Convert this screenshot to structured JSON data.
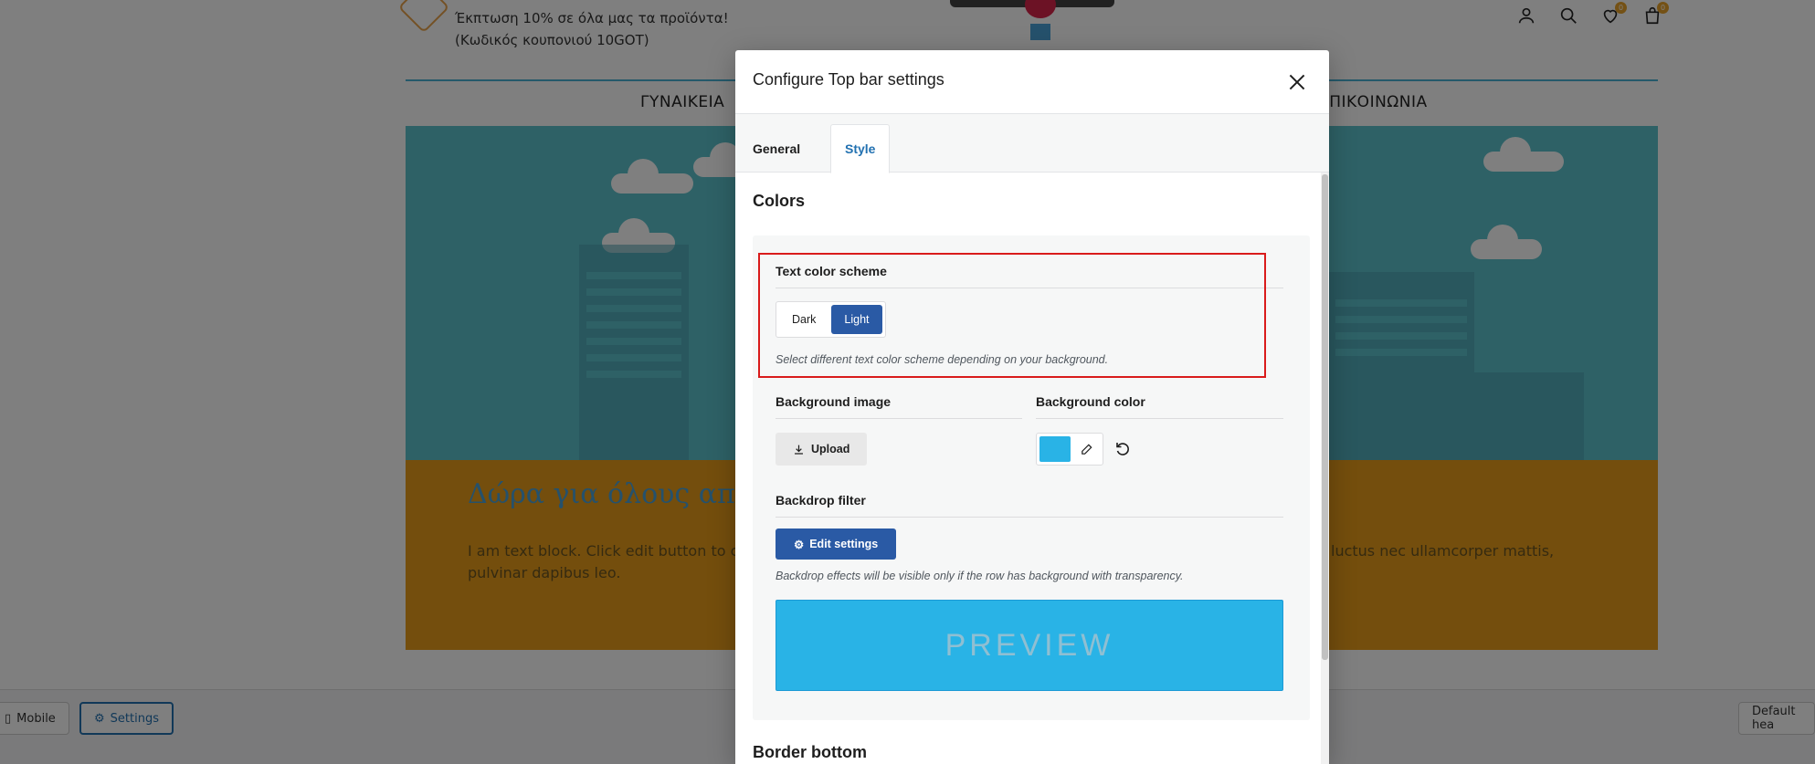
{
  "background_page": {
    "promo_line1": "Έκπτωση 10% σε όλα μας τα προϊόντα!",
    "promo_line2": "(Κωδικός κουπονιού 10GOT)",
    "nav_left": "ΓΥΝΑΙΚΕΙΑ",
    "nav_right": "ΕΠΙΚΟΙΝΩΝΙΑ",
    "headline": "Δώρα για όλους απ",
    "body_text_left": "I am text block. Click edit button to ch",
    "body_text_right": "luctus nec ullamcorper mattis,",
    "body_text_line2": "pulvinar dapibus leo.",
    "cart_badge": "0",
    "wishlist_badge": "0"
  },
  "toolbar": {
    "mobile_label": "Mobile",
    "settings_label": "Settings",
    "default_label": "Default hea"
  },
  "modal": {
    "title": "Configure Top bar settings",
    "tabs": [
      {
        "label": "General",
        "active": false
      },
      {
        "label": "Style",
        "active": true
      }
    ],
    "section_colors": "Colors",
    "text_color_scheme": {
      "label": "Text color scheme",
      "options": [
        "Dark",
        "Light"
      ],
      "selected": "Light",
      "hint": "Select different text color scheme depending on your background."
    },
    "background_image": {
      "label": "Background image",
      "upload_label": "Upload"
    },
    "background_color": {
      "label": "Background color",
      "value": "#29b3e6"
    },
    "backdrop_filter": {
      "label": "Backdrop filter",
      "button_label": "Edit settings",
      "hint": "Backdrop effects will be visible only if the row has background with transparency."
    },
    "preview_text": "PREVIEW",
    "section_border_bottom": "Border bottom"
  },
  "colors": {
    "accent_blue": "#2a5aa5",
    "tab_active": "#2271b1",
    "highlight_red": "#d91b1b",
    "swatch": "#29b3e6"
  },
  "icons": [
    "close-icon",
    "download-icon",
    "eyedropper-icon",
    "reset-icon",
    "gear-icon",
    "user-icon",
    "search-icon",
    "heart-icon",
    "cart-icon",
    "mobile-icon"
  ]
}
